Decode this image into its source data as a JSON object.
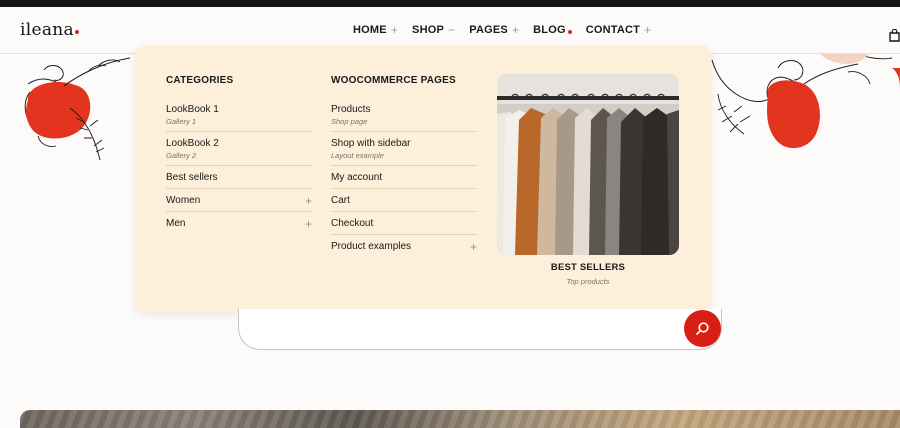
{
  "brand": {
    "logo_text": "ileana",
    "accent_color": "#d62b1c"
  },
  "nav": {
    "items": [
      {
        "label": "HOME",
        "marker": "+"
      },
      {
        "label": "SHOP",
        "marker": "−"
      },
      {
        "label": "PAGES",
        "marker": "+"
      },
      {
        "label": "BLOG",
        "marker": "dot"
      },
      {
        "label": "CONTACT",
        "marker": "+"
      }
    ],
    "cart_icon": "shopping-bag-icon"
  },
  "mega_menu": {
    "categories": {
      "heading": "CATEGORIES",
      "items": [
        {
          "label": "LookBook 1",
          "sub": "Gallery 1"
        },
        {
          "label": "LookBook 2",
          "sub": "Gallery 2"
        },
        {
          "label": "Best sellers"
        },
        {
          "label": "Women",
          "expand": "+"
        },
        {
          "label": "Men",
          "expand": "+"
        }
      ]
    },
    "woocommerce": {
      "heading": "WOOCOMMERCE PAGES",
      "items": [
        {
          "label": "Products",
          "sub": "Shop page"
        },
        {
          "label": "Shop with sidebar",
          "sub": "Layout example"
        },
        {
          "label": "My account"
        },
        {
          "label": "Cart"
        },
        {
          "label": "Checkout"
        },
        {
          "label": "Product examples",
          "expand": "+"
        }
      ]
    },
    "promo": {
      "title": "BEST SELLERS",
      "subtitle": "Top products"
    }
  },
  "search": {
    "placeholder": "",
    "button_icon": "search-icon",
    "button_color": "#d91f14"
  }
}
